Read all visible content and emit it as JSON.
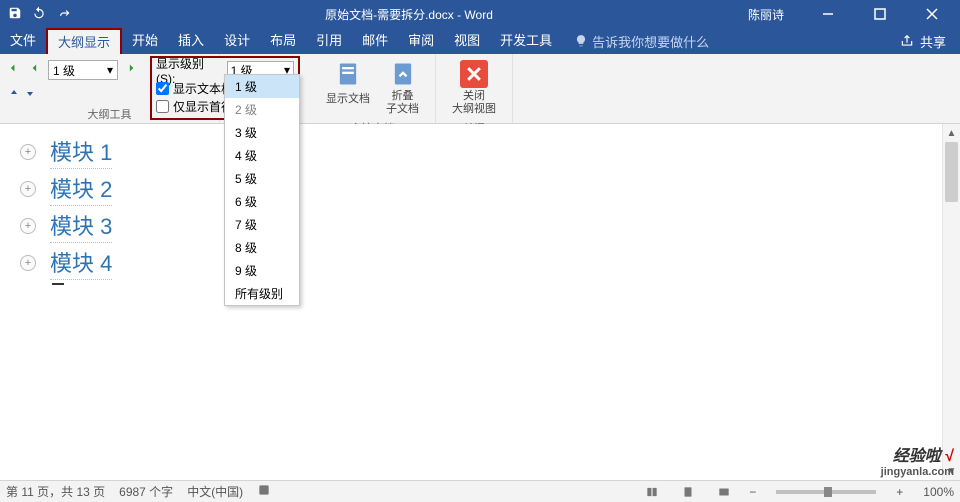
{
  "title": "原始文档-需要拆分.docx - Word",
  "user": "陈丽诗",
  "tabs": {
    "file": "文件",
    "outline": "大纲显示",
    "home": "开始",
    "insert": "插入",
    "design": "设计",
    "layout": "布局",
    "references": "引用",
    "mail": "邮件",
    "review": "审阅",
    "view": "视图",
    "dev": "开发工具"
  },
  "tell_me": "告诉我你想要做什么",
  "share": "共享",
  "outline": {
    "level_value": "1 级",
    "show_level_label": "显示级别(S):",
    "show_level_value": "1 级",
    "show_format": "显示文本格式",
    "first_line_only": "仅显示首行",
    "group_label": "大纲工具"
  },
  "dropdown_items": [
    "1 级",
    "2 级",
    "3 级",
    "4 级",
    "5 级",
    "6 级",
    "7 级",
    "8 级",
    "9 级",
    "所有级别"
  ],
  "master": {
    "show": "显示文档",
    "collapse1": "折叠",
    "collapse2": "子文档",
    "label": "主控文档"
  },
  "close": {
    "line1": "关闭",
    "line2": "大纲视图",
    "label": "关闭"
  },
  "doc": {
    "items": [
      "模块 1",
      "模块 2",
      "模块 3",
      "模块 4"
    ]
  },
  "status": {
    "page": "第 11 页，共 13 页",
    "words": "6987 个字",
    "lang": "中文(中国)",
    "zoom": "100%"
  },
  "watermark": {
    "brand": "经验啦",
    "check": "√",
    "url": "jingyanla.com"
  }
}
